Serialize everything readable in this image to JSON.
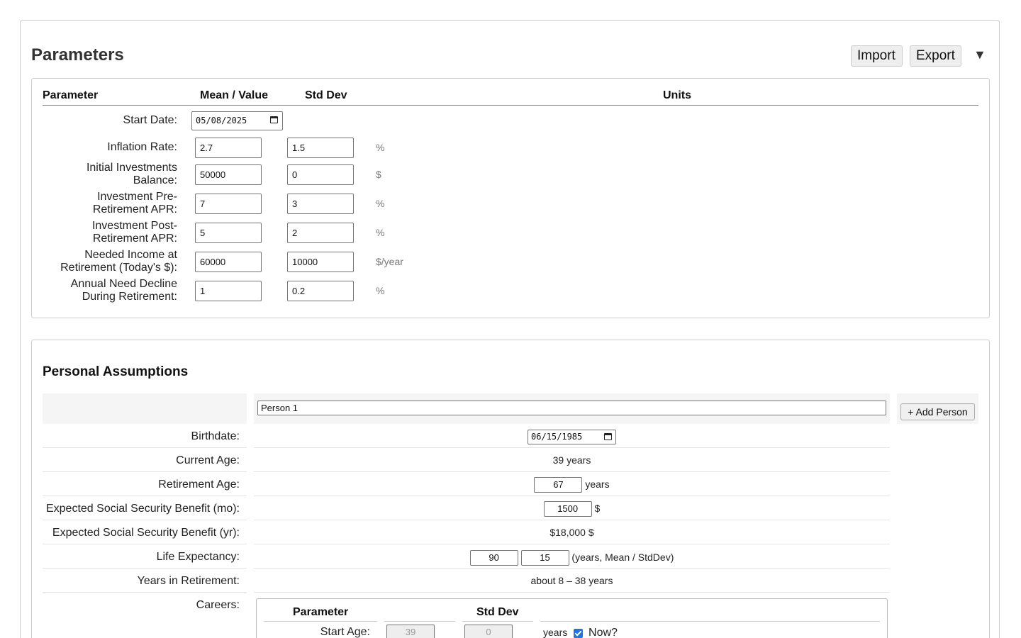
{
  "header": {
    "title": "Parameters",
    "import_label": "Import",
    "export_label": "Export",
    "menu_glyph": "▼"
  },
  "params_table": {
    "col_parameter": "Parameter",
    "col_mean": "Mean / Value",
    "col_std": "Std Dev",
    "col_units": "Units",
    "start_date_label": "Start Date:",
    "start_date_value": "05/08/2025",
    "rows": [
      {
        "label1": "Inflation Rate:",
        "label2": "",
        "mean": "2.7",
        "std": "1.5",
        "unit": "%"
      },
      {
        "label1": "Initial Investments",
        "label2": "Balance:",
        "mean": "50000",
        "std": "0",
        "unit": "$"
      },
      {
        "label1": "Investment Pre-",
        "label2": "Retirement APR:",
        "mean": "7",
        "std": "3",
        "unit": "%"
      },
      {
        "label1": "Investment Post-",
        "label2": "Retirement APR:",
        "mean": "5",
        "std": "2",
        "unit": "%"
      },
      {
        "label1": "Needed Income at",
        "label2": "Retirement (Today's $):",
        "mean": "60000",
        "std": "10000",
        "unit": "$/year"
      },
      {
        "label1": "Annual Need Decline",
        "label2": "During Retirement:",
        "mean": "1",
        "std": "0.2",
        "unit": "%"
      }
    ]
  },
  "personal": {
    "title": "Personal Assumptions",
    "person_name": "Person 1",
    "add_person_label": "+ Add Person",
    "birthdate_label": "Birthdate:",
    "birthdate_value": "06/15/1985",
    "current_age_label": "Current Age:",
    "current_age_value": "39 years",
    "retirement_age_label": "Retirement Age:",
    "retirement_age_value": "67",
    "retirement_age_unit": "years",
    "ss_mo_label": "Expected Social Security Benefit (mo):",
    "ss_mo_value": "1500",
    "ss_mo_unit": "$",
    "ss_yr_label": "Expected Social Security Benefit (yr):",
    "ss_yr_value": "$18,000 $",
    "life_exp_label": "Life Expectancy:",
    "life_exp_mean": "90",
    "life_exp_std": "15",
    "life_exp_unit": "(years, Mean / StdDev)",
    "years_retire_label": "Years in Retirement:",
    "years_retire_value": "about 8 – 38 years",
    "careers_label": "Careers:",
    "careers": {
      "col_parameter": "Parameter",
      "col_std": "Std Dev",
      "start_age_label": "Start Age:",
      "start_age_value": "39",
      "start_age_std": "0",
      "start_age_unit": "years",
      "now_label": "Now?",
      "now_checked": true
    }
  }
}
